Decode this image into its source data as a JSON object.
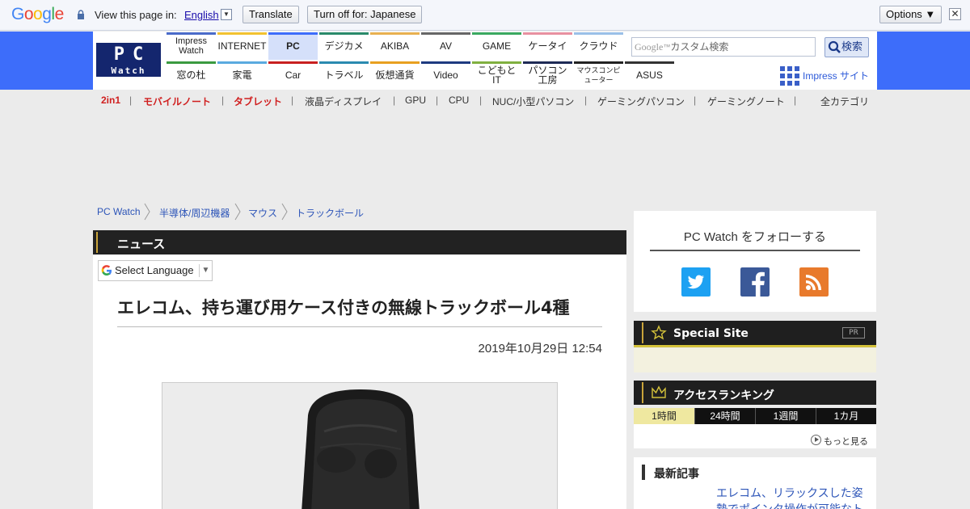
{
  "translate_bar": {
    "view_text": "View this page in:",
    "language": "English",
    "translate_label": "Translate",
    "turn_off_label": "Turn off for: Japanese",
    "options_label": "Options ▼",
    "close_glyph": "✕"
  },
  "header": {
    "logo_top": "PC",
    "logo_bottom": "Watch",
    "nav_top": [
      {
        "label": "Impress Watch",
        "color": "#4a6bc9"
      },
      {
        "label": "INTERNET",
        "color": "#f2c230"
      },
      {
        "label": "PC",
        "color": "#3d6dfa",
        "active": true
      },
      {
        "label": "デジカメ",
        "color": "#2a8a6a"
      },
      {
        "label": "AKIBA",
        "color": "#e8b050"
      },
      {
        "label": "AV",
        "color": "#666666"
      },
      {
        "label": "GAME",
        "color": "#3aa860"
      },
      {
        "label": "ケータイ",
        "color": "#e890a0"
      },
      {
        "label": "クラウド",
        "color": "#9ac0e8"
      }
    ],
    "nav_bottom": [
      {
        "label": "窓の杜",
        "color": "#3a9a40"
      },
      {
        "label": "家電",
        "color": "#5aaadf"
      },
      {
        "label": "Car",
        "color": "#c82020"
      },
      {
        "label": "トラベル",
        "color": "#2a8ab0"
      },
      {
        "label": "仮想通貨",
        "color": "#e8a020"
      },
      {
        "label": "Video",
        "color": "#1e3a80"
      },
      {
        "label": "こどもとIT",
        "color": "#80b040"
      },
      {
        "label": "パソコン工房",
        "color": "#1e2a55"
      },
      {
        "label": "マウスコンピューター",
        "color": "#222222"
      },
      {
        "label": "ASUS",
        "color": "#333333"
      }
    ],
    "search_placeholder": "カスタム検索",
    "search_google": "Google",
    "search_button": "検索",
    "impress_site": "Impress サイト"
  },
  "subnav": {
    "items": [
      {
        "label": "2in1",
        "highlight": true
      },
      {
        "label": "モバイルノート",
        "highlight": true
      },
      {
        "label": "タブレット",
        "highlight": true
      },
      {
        "label": "液晶ディスプレイ",
        "highlight": false
      },
      {
        "label": "GPU",
        "highlight": false
      },
      {
        "label": "CPU",
        "highlight": false
      },
      {
        "label": "NUC/小型パソコン",
        "highlight": false
      },
      {
        "label": "ゲーミングパソコン",
        "highlight": false
      },
      {
        "label": "ゲーミングノート",
        "highlight": false
      }
    ],
    "all_categories": "全カテゴリ",
    "separator": "|"
  },
  "breadcrumb": [
    "PC Watch",
    "半導体/周辺機器",
    "マウス",
    "トラックボール"
  ],
  "article": {
    "section": "ニュース",
    "select_language": "Select Language",
    "title": "エレコム、持ち運び用ケース付きの無線トラックボール4種",
    "date": "2019年10月29日 12:54"
  },
  "sidebar": {
    "follow_title": "PC Watch をフォローする",
    "social": [
      "twitter-icon",
      "facebook-icon",
      "rss-icon"
    ],
    "special_site": "Special Site",
    "pr": "PR",
    "ranking_title": "アクセスランキング",
    "ranking_tabs": [
      "1時間",
      "24時間",
      "1週間",
      "1カ月"
    ],
    "more": "もっと見る",
    "latest_title": "最新記事",
    "latest_item": "エレコム、リラックスした姿勢でポインタ操作が可能なト"
  }
}
